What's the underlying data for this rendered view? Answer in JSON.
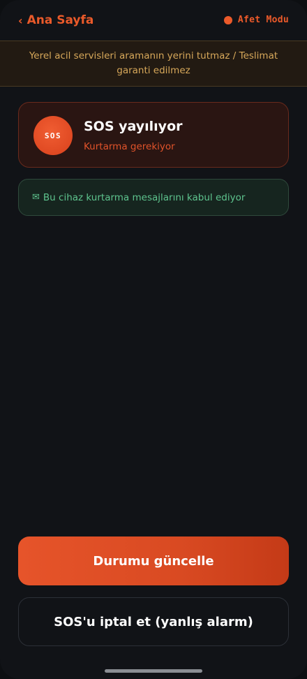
{
  "header": {
    "back_chevron": "‹",
    "back_label": "Ana Sayfa",
    "mode_label": "Afet Modu"
  },
  "disclaimer": {
    "text": "Yerel acil servisleri aramanın yerini tutmaz / Teslimat garanti edilmez"
  },
  "sos_card": {
    "badge": "SOS",
    "title": "SOS yayılıyor",
    "subtitle": "Kurtarma gerekiyor"
  },
  "notice": {
    "icon": "envelope-icon",
    "icon_glyph": "✉",
    "text": "Bu cihaz kurtarma mesajlarını kabul ediyor"
  },
  "actions": {
    "update_status_label": "Durumu güncelle",
    "cancel_sos_label": "SOS'u iptal et (yanlış alarm)"
  },
  "colors": {
    "accent": "#ec5a2a",
    "warning_text": "#d7a85a",
    "success_text": "#5ec48e",
    "background": "#111317"
  }
}
